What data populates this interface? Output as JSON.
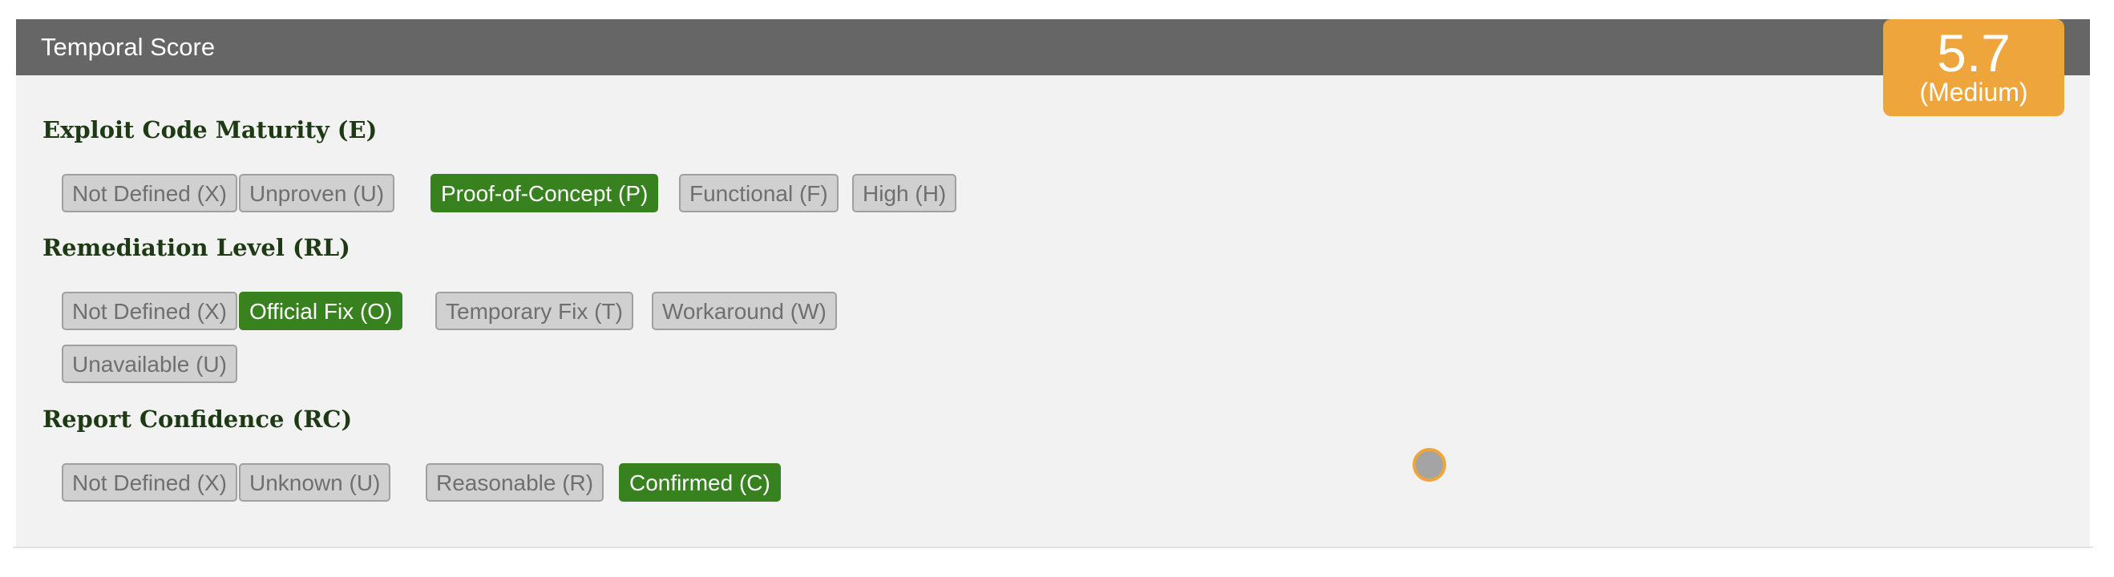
{
  "header": {
    "title": "Temporal Score"
  },
  "score": {
    "value": "5.7",
    "label": "(Medium)",
    "color": "#eea63c"
  },
  "colors": {
    "selected": "#37821f",
    "unselected": "#d0d0d0",
    "header": "#666666",
    "section_title": "#1e3a14"
  },
  "sections": [
    {
      "title": "Exploit Code Maturity (E)",
      "options": [
        {
          "label": "Not Defined (X)",
          "selected": false
        },
        {
          "label": "Unproven (U)",
          "selected": false
        },
        {
          "label": "Proof-of-Concept (P)",
          "selected": true
        },
        {
          "label": "Functional (F)",
          "selected": false
        },
        {
          "label": "High (H)",
          "selected": false
        }
      ]
    },
    {
      "title": "Remediation Level (RL)",
      "options": [
        {
          "label": "Not Defined (X)",
          "selected": false
        },
        {
          "label": "Official Fix (O)",
          "selected": true
        },
        {
          "label": "Temporary Fix (T)",
          "selected": false
        },
        {
          "label": "Workaround (W)",
          "selected": false
        },
        {
          "label": "Unavailable (U)",
          "selected": false
        }
      ]
    },
    {
      "title": "Report Confidence (RC)",
      "options": [
        {
          "label": "Not Defined (X)",
          "selected": false
        },
        {
          "label": "Unknown (U)",
          "selected": false
        },
        {
          "label": "Reasonable (R)",
          "selected": false
        },
        {
          "label": "Confirmed (C)",
          "selected": true
        }
      ]
    }
  ]
}
